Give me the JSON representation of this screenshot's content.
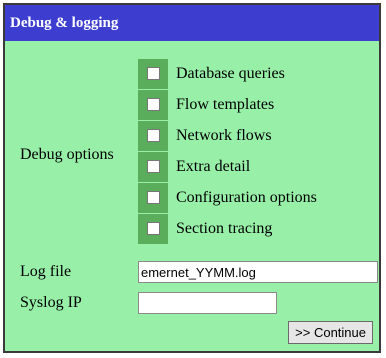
{
  "header": {
    "title": "Debug & logging"
  },
  "debug": {
    "label": "Debug options",
    "options": [
      {
        "label": "Database queries",
        "checked": false
      },
      {
        "label": "Flow templates",
        "checked": false
      },
      {
        "label": "Network flows",
        "checked": false
      },
      {
        "label": "Extra detail",
        "checked": false
      },
      {
        "label": "Configuration options",
        "checked": false
      },
      {
        "label": "Section tracing",
        "checked": false
      }
    ]
  },
  "log_file": {
    "label": "Log file",
    "value": "emernet_YYMM.log"
  },
  "syslog_ip": {
    "label": "Syslog IP",
    "value": ""
  },
  "continue_button": {
    "label": ">> Continue"
  },
  "colors": {
    "header_bg": "#3d3dcf",
    "panel_bg": "#98f0a8",
    "checkbox_cell_bg": "#5aad5a"
  }
}
